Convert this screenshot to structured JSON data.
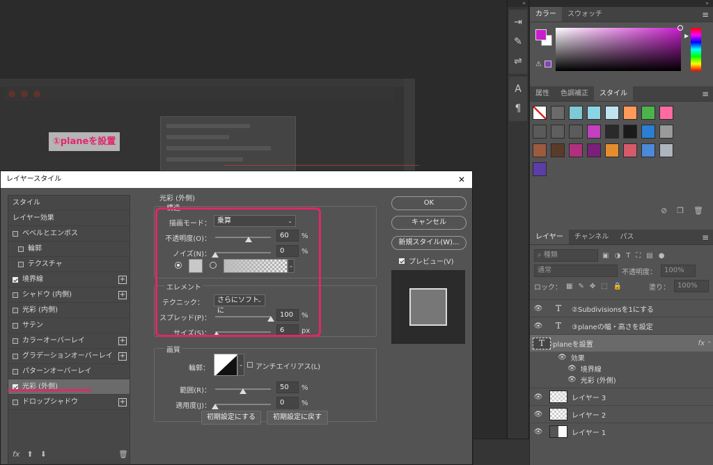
{
  "background": {
    "label": "①planeを設置"
  },
  "color_panel": {
    "tabs": [
      "カラー",
      "スウォッチ"
    ],
    "fg_color": "#c81ecb"
  },
  "styles_panel": {
    "tabs": [
      "属性",
      "色調補正",
      "スタイル"
    ],
    "swatches": [
      "#fff",
      "#6a6a6a",
      "#7ec9d6",
      "#8bd4e3",
      "#bfe4ef",
      "#ff9a5a",
      "#4cb34c",
      "#ff6ba0",
      "#5a5a5a",
      "#5e5e5e",
      "#5b5b5b",
      "#c23fbd",
      "#2a2a2a",
      "#1a1a1a",
      "#2a7fd4",
      "#9a9a9a",
      "#9c5b3f",
      "#5a3b2a",
      "#b0307e",
      "#7a1f7a",
      "#e38d2f",
      "#d65a6a",
      "#4b8ad8",
      "#aeb5bd",
      "#5b3ea8"
    ]
  },
  "layers_panel": {
    "tabs": [
      "レイヤー",
      "チャンネル",
      "パス"
    ],
    "search_label": "種類",
    "blend_mode": "通常",
    "opacity_label": "不透明度：",
    "opacity_value": "100%",
    "lock_label": "ロック：",
    "fill_label": "塗り：",
    "fill_value": "100%",
    "layers": [
      {
        "name": "②Subdivisionsを1にする",
        "kind": "text"
      },
      {
        "name": "③planeの幅・高さを設定",
        "kind": "text"
      },
      {
        "name": "①planeを設置",
        "kind": "text",
        "selected": true
      }
    ],
    "effects_label": "効果",
    "effects": [
      "境界線",
      "光彩 (外側)"
    ],
    "image_layers": [
      "レイヤー 3",
      "レイヤー 2",
      "レイヤー 1"
    ],
    "fx_label": "fx"
  },
  "dialog": {
    "title": "レイヤースタイル",
    "close": "✕",
    "style_list": [
      {
        "label": "スタイル",
        "checkbox": false,
        "checked": false,
        "plus": false,
        "indent": false
      },
      {
        "label": "レイヤー効果",
        "checkbox": false,
        "checked": false,
        "plus": false,
        "indent": false
      },
      {
        "label": "ベベルとエンボス",
        "checkbox": true,
        "checked": false,
        "plus": false,
        "indent": false
      },
      {
        "label": "輪郭",
        "checkbox": true,
        "checked": false,
        "plus": false,
        "indent": true
      },
      {
        "label": "テクスチャ",
        "checkbox": true,
        "checked": false,
        "plus": false,
        "indent": true
      },
      {
        "label": "境界線",
        "checkbox": true,
        "checked": true,
        "plus": true,
        "indent": false
      },
      {
        "label": "シャドウ (内側)",
        "checkbox": true,
        "checked": false,
        "plus": true,
        "indent": false
      },
      {
        "label": "光彩 (内側)",
        "checkbox": true,
        "checked": false,
        "plus": false,
        "indent": false
      },
      {
        "label": "サテン",
        "checkbox": true,
        "checked": false,
        "plus": false,
        "indent": false
      },
      {
        "label": "カラーオーバーレイ",
        "checkbox": true,
        "checked": false,
        "plus": true,
        "indent": false
      },
      {
        "label": "グラデーションオーバーレイ",
        "checkbox": true,
        "checked": false,
        "plus": true,
        "indent": false
      },
      {
        "label": "パターンオーバーレイ",
        "checkbox": true,
        "checked": false,
        "plus": false,
        "indent": false
      },
      {
        "label": "光彩 (外側)",
        "checkbox": true,
        "checked": true,
        "plus": false,
        "indent": false,
        "active": true
      },
      {
        "label": "ドロップシャドウ",
        "checkbox": true,
        "checked": false,
        "plus": true,
        "indent": false
      }
    ],
    "footer_fx": "fx",
    "section_title": "光彩 (外側)",
    "structure": {
      "title": "構造",
      "blend_mode_label": "描画モード：",
      "blend_mode_value": "乗算",
      "opacity_label": "不透明度(O)：",
      "opacity_value": "60",
      "opacity_slider": 0.6,
      "noise_label": "ノイズ(N)：",
      "noise_value": "0",
      "noise_slider": 0,
      "percent": "%"
    },
    "elements": {
      "title": "エレメント",
      "technique_label": "テクニック：",
      "technique_value": "さらにソフトに",
      "spread_label": "スプレッド(P)：",
      "spread_value": "100",
      "spread_slider": 1.0,
      "size_label": "サイズ(S)：",
      "size_value": "6",
      "size_slider": 0.03,
      "percent": "%",
      "px": "px"
    },
    "quality": {
      "title": "画質",
      "contour_label": "輪郭：",
      "antialias_label": "アンチエイリアス(L)",
      "range_label": "範囲(R)：",
      "range_value": "50",
      "range_slider": 0.5,
      "jitter_label": "適用度(J)：",
      "jitter_value": "0",
      "jitter_slider": 0,
      "percent": "%"
    },
    "buttons": {
      "make_default": "初期設定にする",
      "reset_default": "初期設定に戻す",
      "ok": "OK",
      "cancel": "キャンセル",
      "new_style": "新規スタイル(W)...",
      "preview": "プレビュー(V)"
    }
  }
}
